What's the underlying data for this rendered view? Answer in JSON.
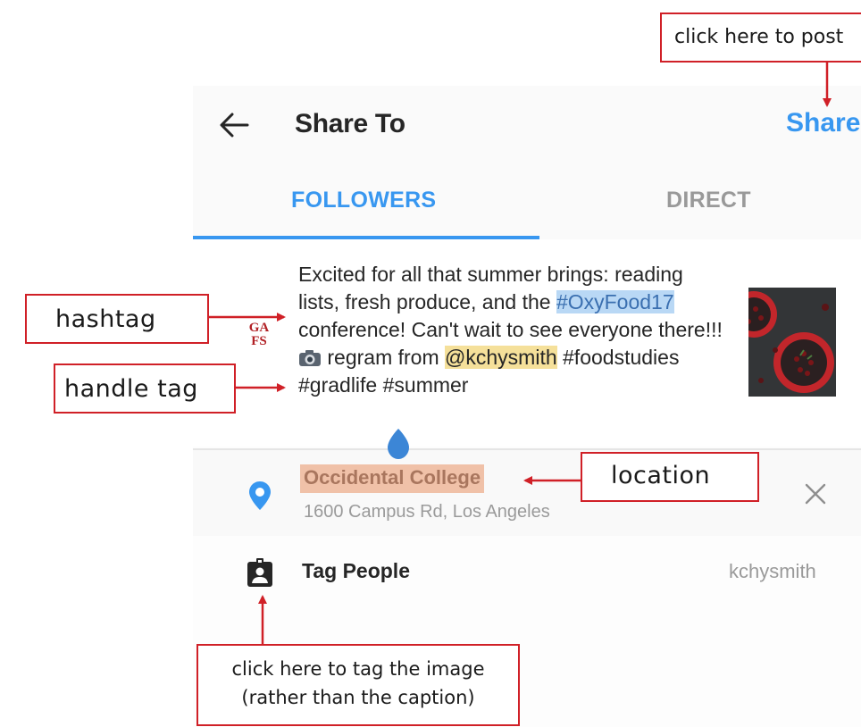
{
  "header": {
    "title": "Share To",
    "share_label": "Share"
  },
  "tabs": [
    {
      "label": "FOLLOWERS",
      "active": true
    },
    {
      "label": "DIRECT",
      "active": false
    }
  ],
  "caption": {
    "avatar_lines": [
      "GA",
      "FS"
    ],
    "text_1": "Excited for all that summer brings: reading lists, fresh produce, and the ",
    "hashtag": "#OxyFood17",
    "text_2": " conference! Can't wait to see everyone there!!! ",
    "text_3": " regram from ",
    "handle": "@kchysmith",
    "text_4": " #foodstudies #gradlife #summer"
  },
  "location": {
    "name": "Occidental College",
    "address": "1600 Campus Rd, Los Angeles"
  },
  "tag_people": {
    "label": "Tag People",
    "value": "kchysmith"
  },
  "annotations": {
    "post": "click here to post",
    "hashtag": "hashtag",
    "handle": "handle tag",
    "location": "location",
    "tag_line_1": "click here to tag the image",
    "tag_line_2": "(rather than the caption)"
  },
  "colors": {
    "accent": "#3897f0",
    "annotation": "#d02027",
    "hashtag_highlight": "#b9d8f5",
    "handle_highlight": "#f5e09a",
    "location_highlight": "#f0c1a8"
  }
}
